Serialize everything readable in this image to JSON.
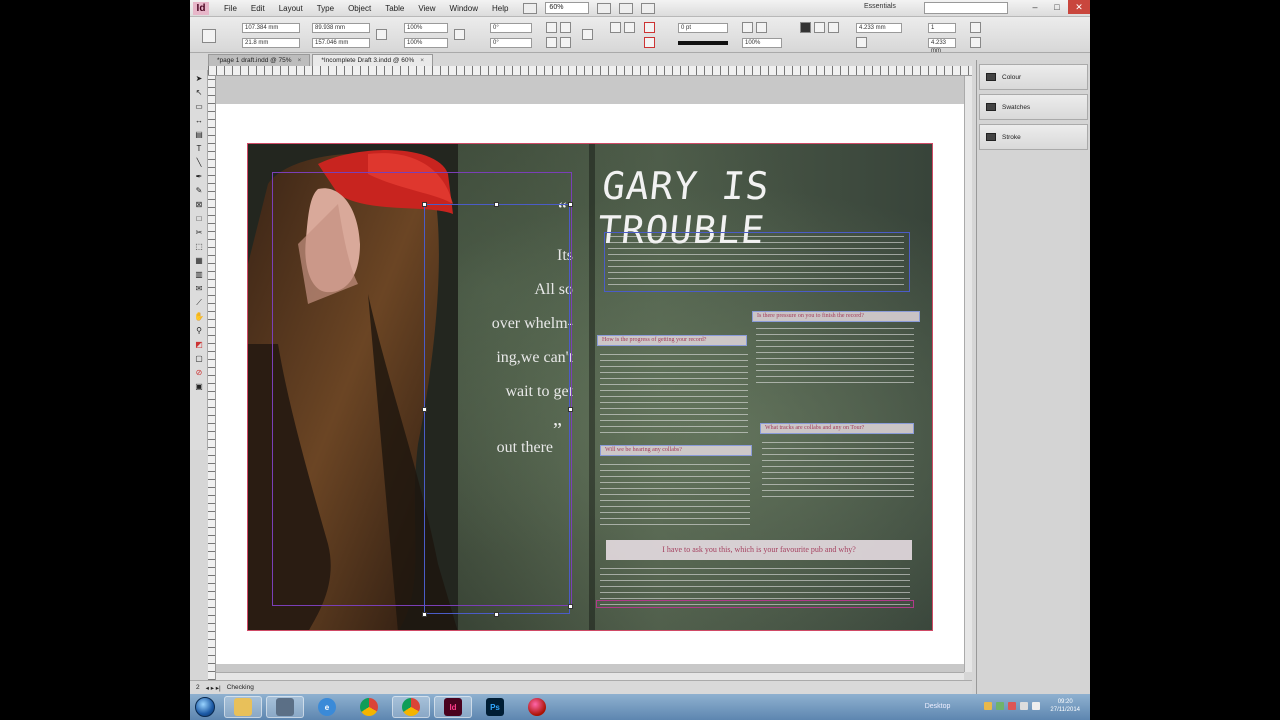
{
  "app": {
    "logo": "Id",
    "menu": [
      "File",
      "Edit",
      "Layout",
      "Type",
      "Object",
      "Table",
      "View",
      "Window",
      "Help"
    ],
    "zoom": "60%",
    "workspace": "Essentials",
    "window_buttons": [
      "–",
      "□",
      "✕"
    ]
  },
  "control_panel": {
    "x": "107.384 mm",
    "y": "21.8 mm",
    "w": "89.938 mm",
    "h": "157.046 mm",
    "scale_x": "100%",
    "scale_y": "100%",
    "rotate": "0°",
    "shear": "0°",
    "stroke_weight": "0 pt",
    "ref_w": "4.233 mm",
    "ref_pct": "100%",
    "cols": "1",
    "gutter": "4.233 mm"
  },
  "tabs": [
    {
      "label": "*page 1 draft.indd @ 75%",
      "active": false
    },
    {
      "label": "*Incomplete Draft 3.indd @ 60%",
      "active": true
    }
  ],
  "panels": [
    "Colour",
    "Swatches",
    "Stroke"
  ],
  "status": {
    "page": "2",
    "preflight": "Checking"
  },
  "spread": {
    "headline": "GARY IS TROUBLE",
    "quote_open": "“",
    "quote_close": "”",
    "quote_lines": [
      "Its",
      "All so",
      "over whelm-",
      "ing,we can't",
      "wait to get",
      "out there"
    ],
    "pull_questions": [
      "How is the progress of getting your record?",
      "Is there pressure on you to finish the record?",
      "Will we be hearing any collabs?",
      "What tracks are collabs and any on Tour?"
    ],
    "big_question": "I have to ask you this, which is your favourite pub and why?"
  },
  "taskbar": {
    "apps": [
      "explorer",
      "media",
      "ie",
      "chrome",
      "chrome",
      "indesign",
      "photoshop",
      "other"
    ],
    "desktop_label": "Desktop",
    "time": "09:20",
    "date": "27/11/2014"
  }
}
